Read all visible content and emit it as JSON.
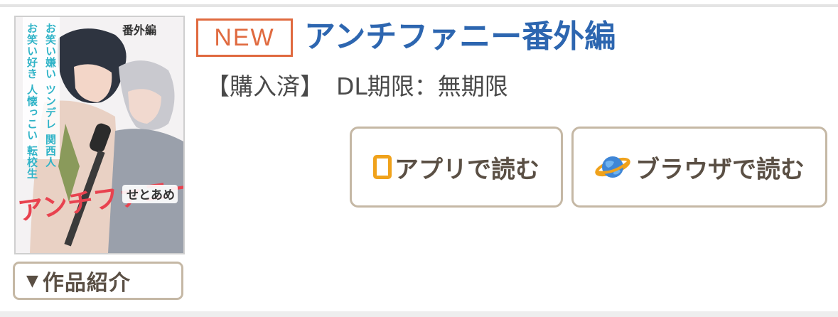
{
  "product": {
    "badge": "NEW",
    "title": "アンチファニー番外編",
    "purchase_status": "【購入済】",
    "download_limit": "DL期限：無期限"
  },
  "cover": {
    "edition_label": "番外編",
    "tagline_line1": "お笑い好き 人懐っこい 転校生",
    "tagline_line2": "お笑い嫌い ツンデレ 関西人",
    "title_art": "アンチファニー",
    "author": "せとあめ"
  },
  "actions": {
    "intro_label": "作品紹介",
    "intro_toggle_icon": "▼",
    "read_in_app_label": "アプリで読む",
    "read_in_browser_label": "ブラウザで読む"
  },
  "colors": {
    "title_blue": "#2d66b0",
    "badge_orange": "#e06a3f",
    "button_border": "#c5b8a5",
    "button_text": "#5a4f44",
    "app_icon_orange": "#f0a21b",
    "cover_title_red": "#e8424f",
    "cover_tagline_teal": "#2fb3c7"
  },
  "icons": {
    "app": "tablet-icon",
    "browser": "globe-icon",
    "intro": "triangle-down-icon"
  }
}
